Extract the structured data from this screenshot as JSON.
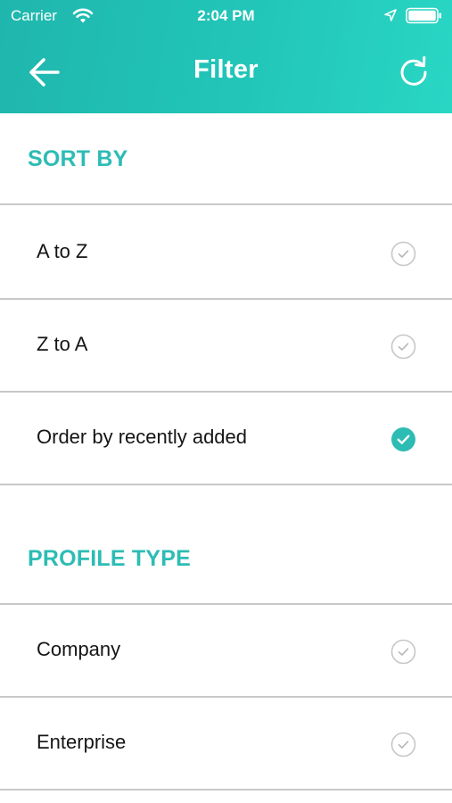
{
  "status_bar": {
    "carrier": "Carrier",
    "time": "2:04 PM",
    "icons": [
      "wifi-icon",
      "location-arrow-icon",
      "battery-icon"
    ]
  },
  "nav_bar": {
    "title": "Filter",
    "back_icon": "arrow-left-icon",
    "refresh_icon": "refresh-icon"
  },
  "sections": [
    {
      "title": "SORT BY",
      "options": [
        {
          "label": "A to Z",
          "selected": false
        },
        {
          "label": "Z to A",
          "selected": false
        },
        {
          "label": "Order by recently added",
          "selected": true
        }
      ]
    },
    {
      "title": "PROFILE TYPE",
      "options": [
        {
          "label": "Company",
          "selected": false
        },
        {
          "label": "Enterprise",
          "selected": false
        }
      ]
    }
  ],
  "colors": {
    "accent": "#2dbcb4",
    "header_gradient_start": "#1fb6ad",
    "header_gradient_end": "#29d6c4",
    "divider": "#c8c8c8",
    "unchecked_circle": "#c7c7c7"
  }
}
